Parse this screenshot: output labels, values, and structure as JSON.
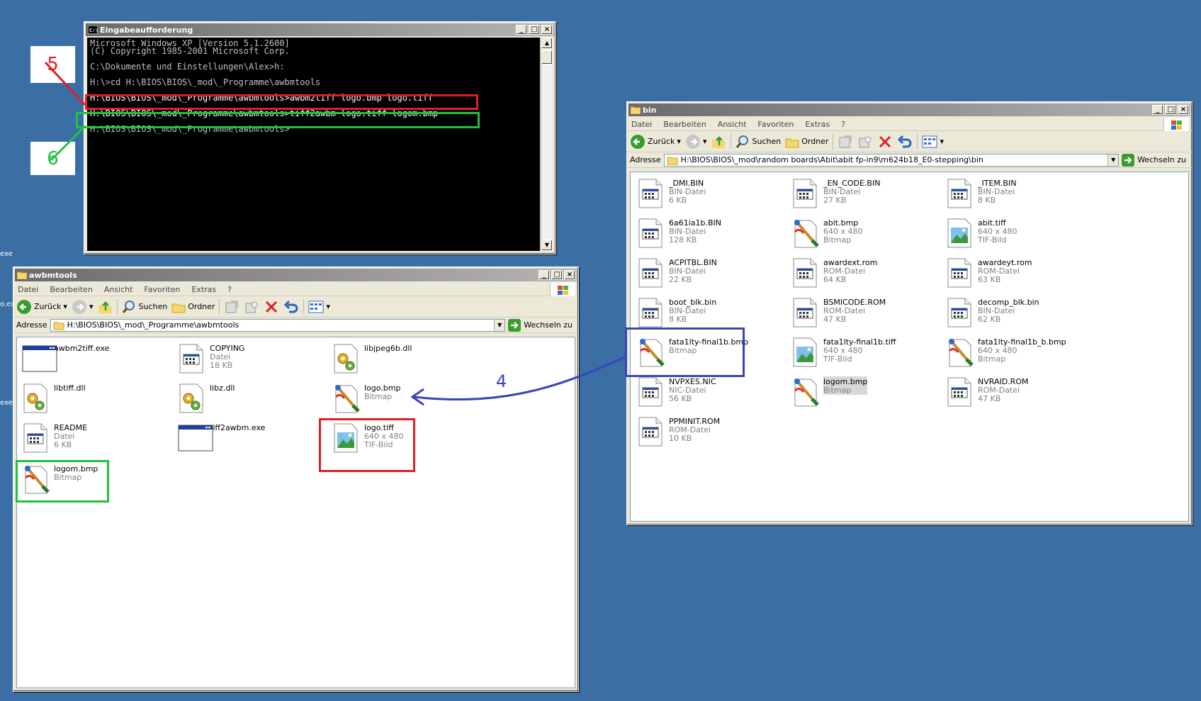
{
  "cmd": {
    "title": "Eingabeaufforderung",
    "lines": [
      "Microsoft Windows XP [Version 5.1.2600]",
      "(C) Copyright 1985-2001 Microsoft Corp.",
      "",
      "C:\\Dokumente und Einstellungen\\Alex>h:",
      "",
      "H:\\>cd H:\\BIOS\\BIOS\\_mod\\_Programme\\awbmtools",
      "",
      "H:\\BIOS\\BIOS\\_mod\\_Programme\\awbmtools>awbm2tiff logo.bmp logo.tiff",
      "",
      "H:\\BIOS\\BIOS\\_mod\\_Programme\\awbmtools>tiff2awbm logo.tiff logom.bmp",
      "",
      "H:\\BIOS\\BIOS\\_mod\\_Programme\\awbmtools>"
    ]
  },
  "menu": [
    "Datei",
    "Bearbeiten",
    "Ansicht",
    "Favoriten",
    "Extras",
    "?"
  ],
  "toolbar": {
    "back": "Zurück",
    "search": "Suchen",
    "folders": "Ordner"
  },
  "address_label": "Adresse",
  "go_label": "Wechseln zu",
  "left": {
    "title": "awbmtools",
    "address": "H:\\BIOS\\BIOS\\_mod\\_Programme\\awbmtools",
    "items": [
      {
        "name": "awbm2tiff.exe",
        "sub": "",
        "sub2": "",
        "icon": "exe-icon"
      },
      {
        "name": "COPYING",
        "sub": "Datei",
        "sub2": "18 KB",
        "icon": "file-icon"
      },
      {
        "name": "libjpeg6b.dll",
        "sub": "",
        "sub2": "",
        "icon": "dll-icon"
      },
      {
        "name": "libtiff.dll",
        "sub": "",
        "sub2": "",
        "icon": "dll-icon"
      },
      {
        "name": "libz.dll",
        "sub": "",
        "sub2": "",
        "icon": "dll-icon"
      },
      {
        "name": "logo.bmp",
        "sub": "Bitmap",
        "sub2": "",
        "icon": "bitmap-icon"
      },
      {
        "name": "README",
        "sub": "Datei",
        "sub2": "6 KB",
        "icon": "file-icon"
      },
      {
        "name": "tiff2awbm.exe",
        "sub": "",
        "sub2": "",
        "icon": "exe-icon"
      },
      {
        "name": "logo.tiff",
        "sub": "640 x 480",
        "sub2": "TIF-Bild",
        "icon": "tiff-icon"
      },
      {
        "name": "logom.bmp",
        "sub": "Bitmap",
        "sub2": "",
        "icon": "bitmap-icon"
      }
    ]
  },
  "right": {
    "title": "bin",
    "address": "H:\\BIOS\\BIOS\\_mod\\random boards\\Abit\\abit fp-in9\\m624b18_E0-stepping\\bin",
    "items": [
      {
        "name": "_DMI.BIN",
        "sub": "BIN-Datei",
        "sub2": "6 KB",
        "icon": "file-icon"
      },
      {
        "name": "_EN_CODE.BIN",
        "sub": "BIN-Datei",
        "sub2": "27 KB",
        "icon": "file-icon"
      },
      {
        "name": "_ITEM.BIN",
        "sub": "BIN-Datei",
        "sub2": "8 KB",
        "icon": "file-icon"
      },
      {
        "name": "6a61ia1b.BIN",
        "sub": "BIN-Datei",
        "sub2": "128 KB",
        "icon": "file-icon"
      },
      {
        "name": "abit.bmp",
        "sub": "640 x 480",
        "sub2": "Bitmap",
        "icon": "bitmap-icon"
      },
      {
        "name": "abit.tiff",
        "sub": "640 x 480",
        "sub2": "TIF-Bild",
        "icon": "tiff-icon"
      },
      {
        "name": "ACPITBL.BIN",
        "sub": "BIN-Datei",
        "sub2": "22 KB",
        "icon": "file-icon"
      },
      {
        "name": "awardext.rom",
        "sub": "ROM-Datei",
        "sub2": "64 KB",
        "icon": "file-icon"
      },
      {
        "name": "awardeyt.rom",
        "sub": "ROM-Datei",
        "sub2": "63 KB",
        "icon": "file-icon"
      },
      {
        "name": "boot_blk.bin",
        "sub": "BIN-Datei",
        "sub2": "8 KB",
        "icon": "file-icon"
      },
      {
        "name": "BSMICODE.ROM",
        "sub": "ROM-Datei",
        "sub2": "47 KB",
        "icon": "file-icon"
      },
      {
        "name": "decomp_blk.bin",
        "sub": "BIN-Datei",
        "sub2": "62 KB",
        "icon": "file-icon"
      },
      {
        "name": "fata1lty-final1b.bmp",
        "sub": "Bitmap",
        "sub2": "",
        "icon": "bitmap-icon"
      },
      {
        "name": "fata1lty-final1b.tiff",
        "sub": "640 x 480",
        "sub2": "TIF-Bild",
        "icon": "tiff-icon"
      },
      {
        "name": "fata1lty-final1b_b.bmp",
        "sub": "640 x 480",
        "sub2": "Bitmap",
        "icon": "bitmap-icon"
      },
      {
        "name": "NVPXES.NIC",
        "sub": "NIC-Datei",
        "sub2": "56 KB",
        "icon": "file-icon"
      },
      {
        "name": "logom.bmp",
        "sub": "Bitmap",
        "sub2": "",
        "icon": "bitmap-icon"
      },
      {
        "name": "NVRAID.ROM",
        "sub": "ROM-Datei",
        "sub2": "47 KB",
        "icon": "file-icon"
      },
      {
        "name": "PPMINIT.ROM",
        "sub": "ROM-Datei",
        "sub2": "10 KB",
        "icon": "file-icon"
      }
    ]
  },
  "annotations": {
    "step4": "4",
    "step5": "5",
    "step6": "6"
  },
  "desktop_edge": [
    "exe",
    "o.ex",
    "exe"
  ],
  "colors": {
    "desktop": "#3a6ea5",
    "red": "#e02020",
    "green": "#22c040",
    "blue": "#3a44b8"
  }
}
